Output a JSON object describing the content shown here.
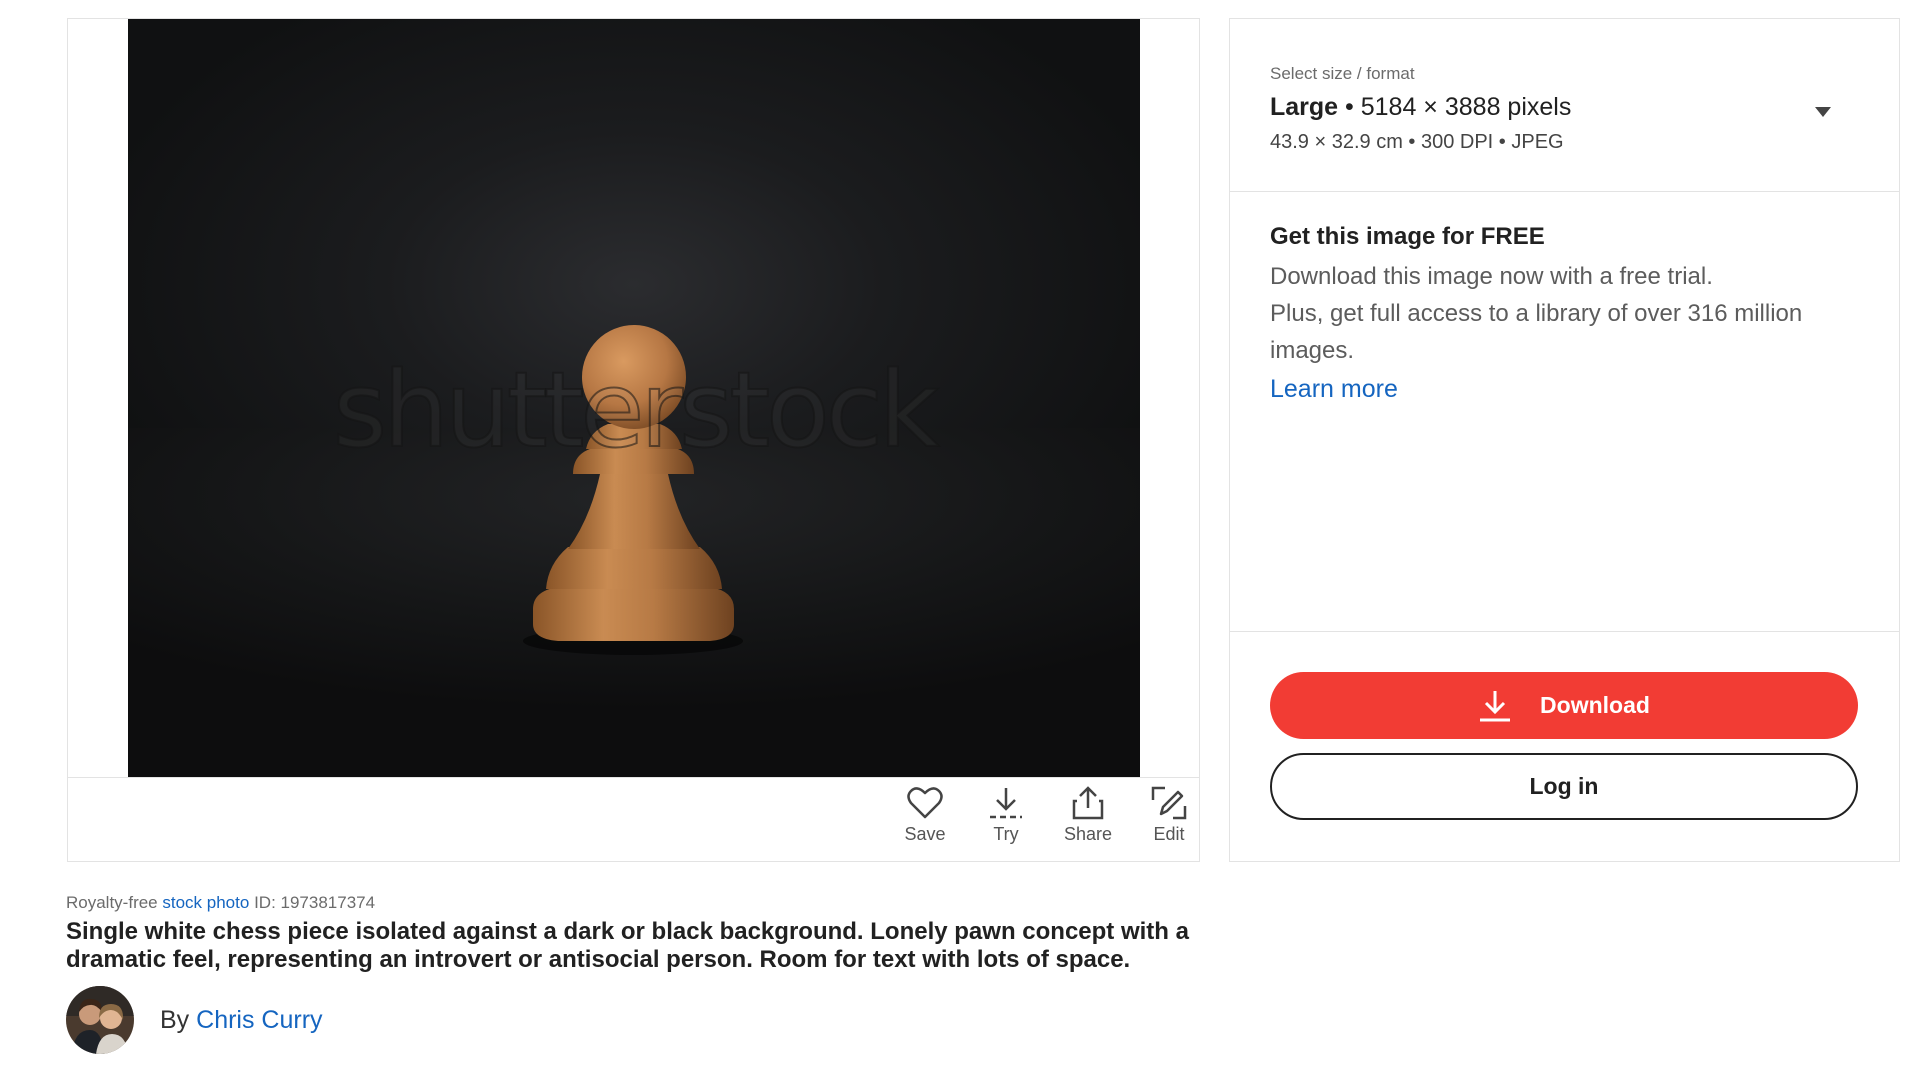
{
  "image": {
    "watermark": "shutterstock",
    "alt": "Single white chess piece isolated against a dark or black background."
  },
  "actions": [
    {
      "label": "Save",
      "icon": "heart-icon"
    },
    {
      "label": "Try",
      "icon": "download-icon"
    },
    {
      "label": "Share",
      "icon": "share-icon"
    },
    {
      "label": "Edit",
      "icon": "edit-icon"
    }
  ],
  "meta": {
    "prefix": "Royalty-free",
    "link": "stock photo",
    "id_label": "ID: 1973817374"
  },
  "description": "Single white chess piece isolated against a dark or black background. Lonely pawn concept with a dramatic feel, representing an introvert or antisocial person. Room for text with lots of space.",
  "author": {
    "prefix": "By",
    "name": "Chris Curry"
  },
  "size_select": {
    "caption": "Select size / format",
    "size_name": "Large",
    "dimensions": "• 5184 × 3888 pixels",
    "details": "43.9 × 32.9 cm • 300 DPI • JPEG"
  },
  "promo": {
    "title": "Get this image for FREE",
    "line1": "Download this image now with a free trial.",
    "line2": "Plus, get full access to a library of over 316 million images.",
    "link": "Learn more"
  },
  "buttons": {
    "download": "Download",
    "login": "Log in"
  },
  "colors": {
    "accent_red": "#f23c34",
    "link_blue": "#1565c0"
  }
}
